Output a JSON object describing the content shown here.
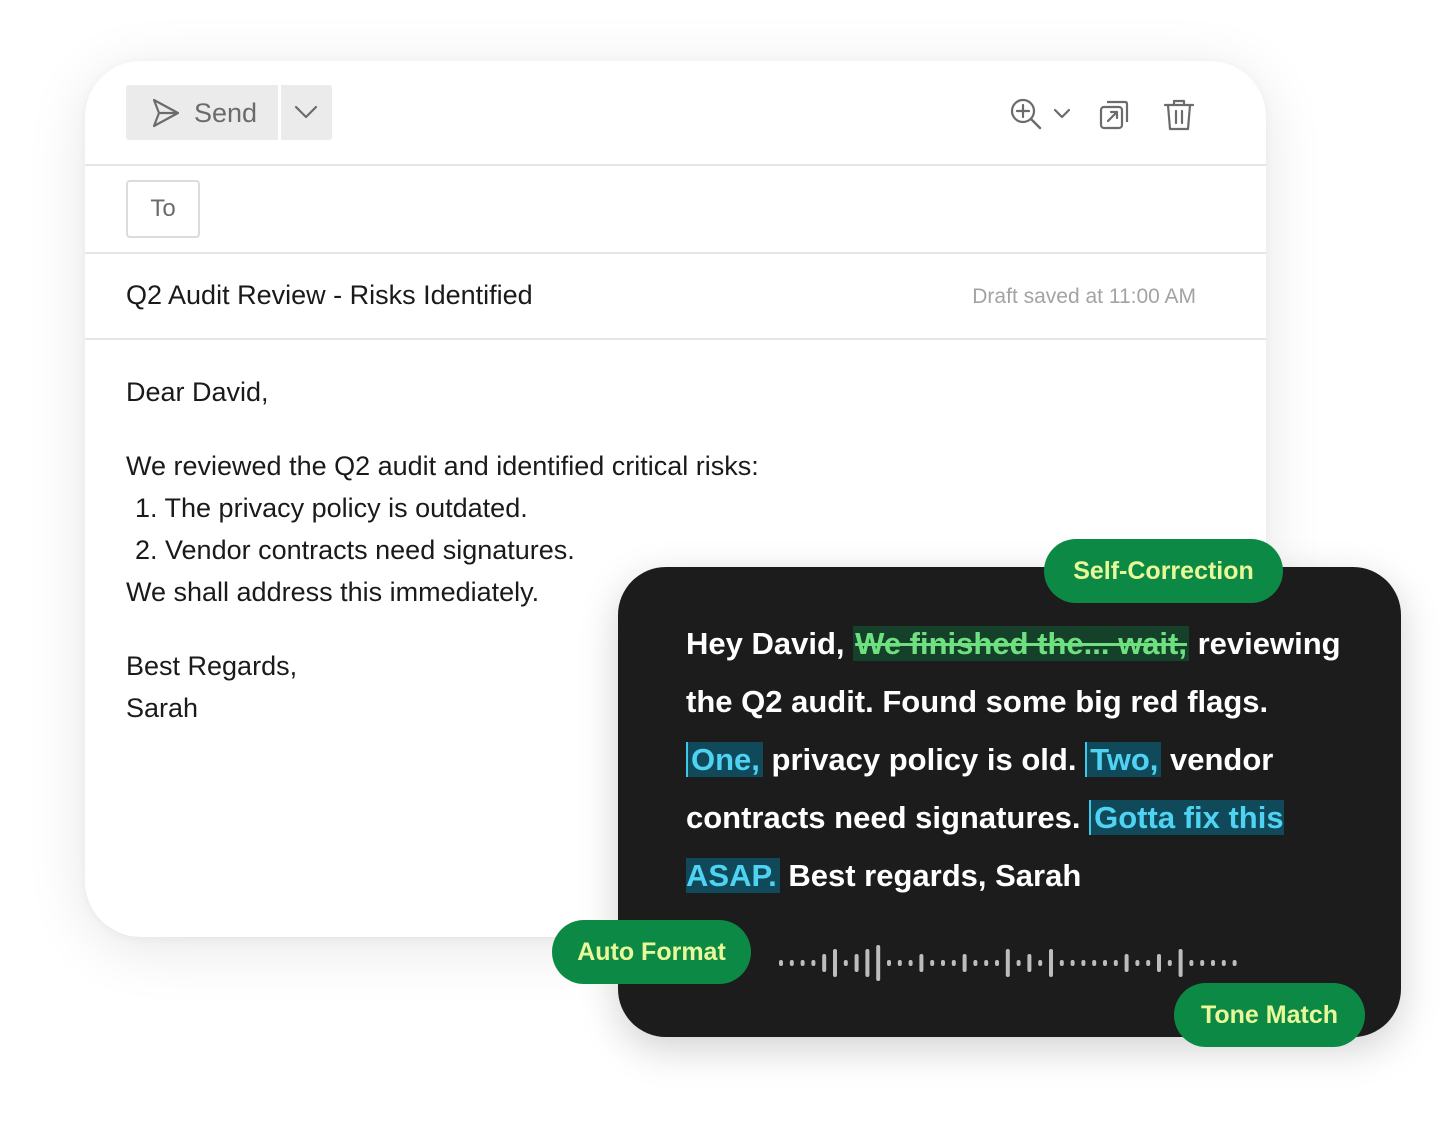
{
  "toolbar": {
    "send_label": "Send",
    "icons": [
      "send-icon",
      "chevron-down-icon",
      "zoom-in-icon",
      "popout-icon",
      "trash-icon"
    ]
  },
  "compose": {
    "to_label": "To",
    "subject": "Q2 Audit Review - Risks Identified",
    "draft_status": "Draft saved at 11:00 AM",
    "body": {
      "greeting": "Dear David,",
      "intro": "We reviewed the Q2 audit and identified critical risks:",
      "items": [
        "1. The privacy policy is outdated.",
        "2. Vendor contracts need signatures."
      ],
      "closing_line": "We shall address this immediately.",
      "signoff": "Best Regards,",
      "signature": "Sarah"
    }
  },
  "voice": {
    "t1": "Hey David, ",
    "strike": "We finished the... wait,",
    "t2": " reviewing the Q2 audit. Found some big red flags.",
    "h1": "One,",
    "t3": " privacy policy is old. ",
    "h2": "Two,",
    "t4": " vendor contracts need signatures. ",
    "h3": "Gotta fix this ASAP.",
    "t5": " Best regards, Sarah"
  },
  "badges": {
    "self_correction": "Self-Correction",
    "auto_format": "Auto Format",
    "tone_match": "Tone Match"
  },
  "colors": {
    "pill_bg": "#0c8a45",
    "pill_text": "#e9f99a",
    "dark_card": "#1c1c1c",
    "highlight_text": "#4fd3f2",
    "strike_text": "#6fe07f"
  }
}
